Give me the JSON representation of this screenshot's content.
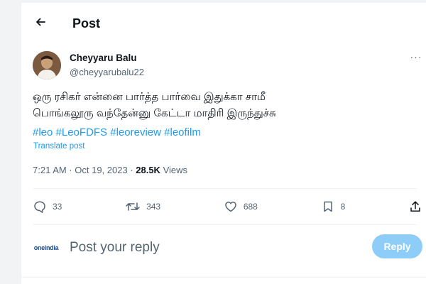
{
  "header": {
    "title": "Post"
  },
  "post": {
    "author_name": "Cheyyaru Balu",
    "author_handle": "@cheyyarubalu22",
    "text": "ஒரு ரசிகர் என்னை பார்த்த பார்வை இதுக்கா சாமீ\nபொங்கலூரு வந்தேன்னு கேட்டா மாதிரி இருந்துச்சு",
    "hashtags": [
      "#leo",
      "#LeoFDFS",
      "#leoreview",
      "#leofilm"
    ],
    "translate_label": "Translate post",
    "timestamp": "7:21 AM · Oct 19, 2023 · ",
    "views_count": "28.5K",
    "views_label": " Views"
  },
  "actions": {
    "replies": "33",
    "reposts": "343",
    "likes": "688",
    "bookmarks": "8"
  },
  "reply_box": {
    "avatar_text": "oneindia",
    "placeholder": "Post your reply",
    "button_label": "Reply"
  },
  "colors": {
    "accent": "#1d9bf0",
    "reply_button_disabled": "#8ecdf7",
    "secondary_text": "#536471"
  },
  "icons": [
    "back-arrow-icon",
    "more-icon",
    "reply-icon",
    "repost-icon",
    "like-icon",
    "bookmark-icon",
    "share-icon"
  ]
}
